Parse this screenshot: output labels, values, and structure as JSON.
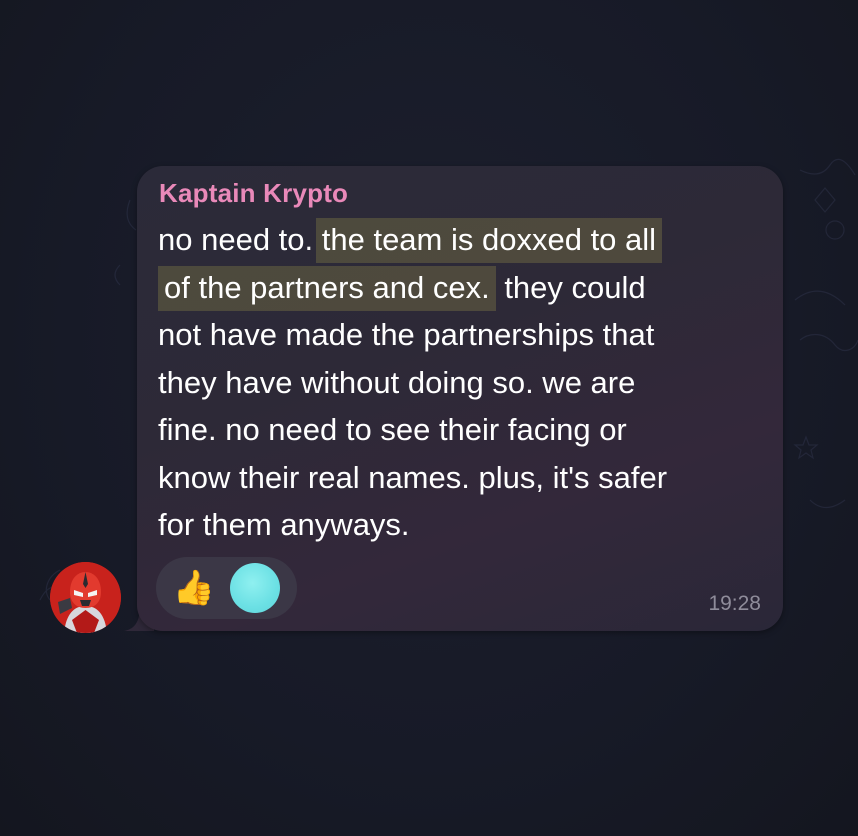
{
  "message": {
    "sender": "Kaptain Krypto",
    "lines": [
      {
        "plain_before": "no need to.  ",
        "highlight": "the team is doxxed to all",
        "plain_after": ""
      },
      {
        "plain_before": "",
        "highlight": "of the partners and cex.",
        "plain_after": "  they could"
      },
      {
        "plain_before": "not have made the partnerships that",
        "highlight": "",
        "plain_after": ""
      },
      {
        "plain_before": "they have without doing so.  we are",
        "highlight": "",
        "plain_after": ""
      },
      {
        "plain_before": "fine.  no need to see their facing or",
        "highlight": "",
        "plain_after": ""
      },
      {
        "plain_before": "know their real names.  plus, it's safer",
        "highlight": "",
        "plain_after": ""
      },
      {
        "plain_before": "for them anyways.",
        "highlight": "",
        "plain_after": ""
      }
    ],
    "time": "19:28",
    "reactions": {
      "emoji": "👍",
      "reactor_avatar_color": "#6be0e4"
    }
  },
  "colors": {
    "background": "#171a27",
    "bubble": "#2d2937",
    "sender_name": "#e989b9",
    "highlight": "#6f6a43",
    "avatar_red": "#c8221c"
  },
  "icons": {
    "sender_avatar": "robot-hero-avatar-icon",
    "reaction": "thumbs-up-icon"
  }
}
